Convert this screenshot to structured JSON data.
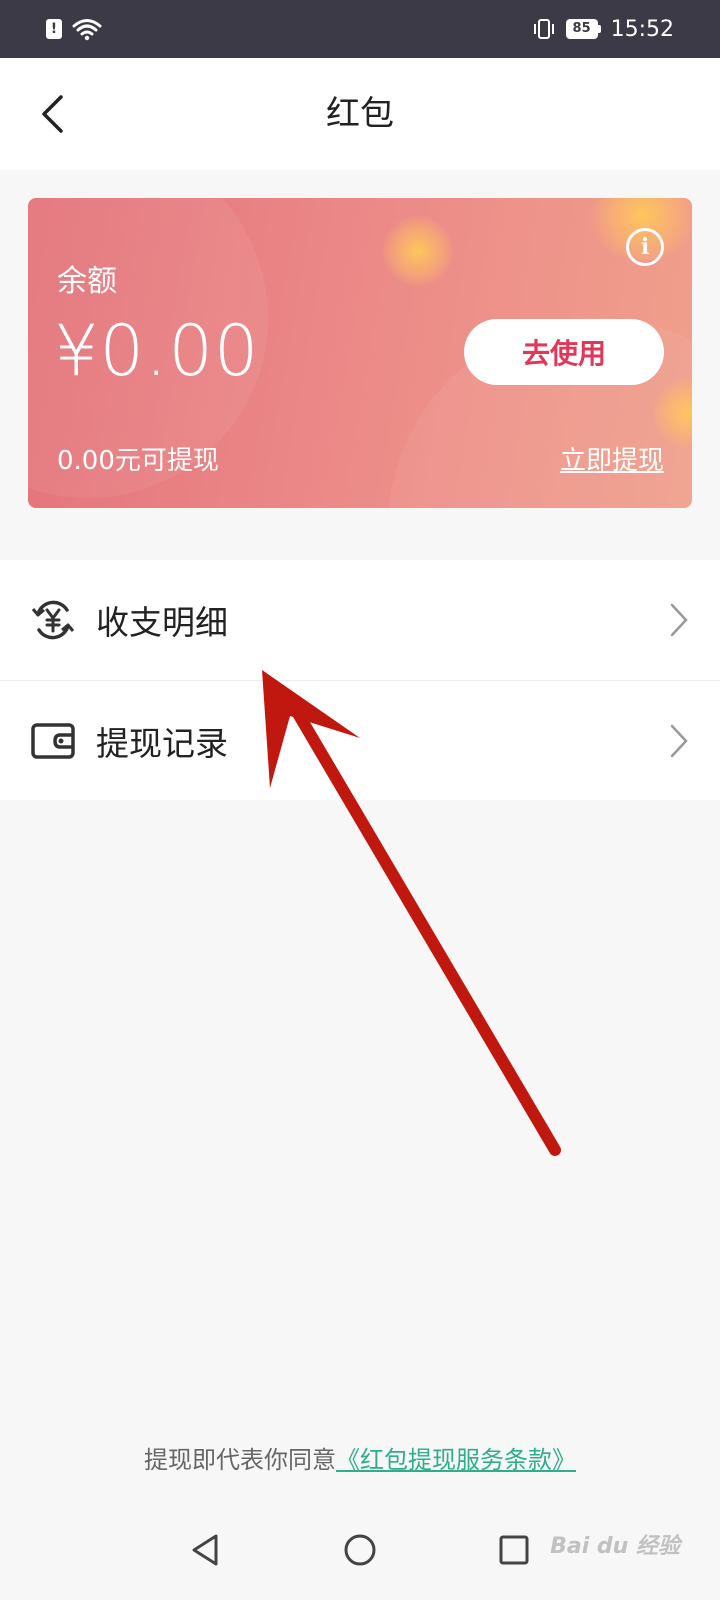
{
  "status_bar": {
    "time": "15:52",
    "battery": "85"
  },
  "header": {
    "title": "红包"
  },
  "card": {
    "balance_label": "余额",
    "balance_amount": "¥0.00",
    "use_button": "去使用",
    "withdrawable_text": "0.00元可提现",
    "withdraw_link": "立即提现"
  },
  "list": {
    "items": [
      {
        "label": "收支明细",
        "icon": "yuan-cycle-icon"
      },
      {
        "label": "提现记录",
        "icon": "wallet-icon"
      }
    ]
  },
  "footer": {
    "agree_text": "提现即代表你同意",
    "terms_link": "《红包提现服务条款》"
  },
  "watermark": "Bai du 经验",
  "colors": {
    "status_bar_bg": "#3c3a47",
    "card_start": "#e3737a",
    "card_end": "#f0a08c",
    "use_button_text": "#e3375a",
    "terms_link": "#2fae8c",
    "annotation_arrow": "#c0180f"
  }
}
